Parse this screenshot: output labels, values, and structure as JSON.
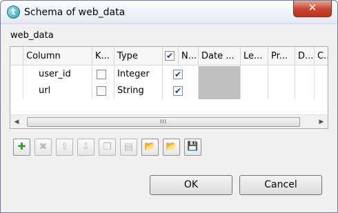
{
  "window": {
    "title": "Schema of web_data",
    "close_glyph": "✕",
    "app_icon_letter": "t"
  },
  "group_label": "web_data",
  "table": {
    "columns": [
      "Column",
      "K...",
      "Type",
      "N...",
      "Date ...",
      "Le...",
      "Pr...",
      "D...",
      "C..."
    ],
    "header_checkbox_checked": true,
    "rows": [
      {
        "column": "user_id",
        "key": false,
        "type": "Integer",
        "nullable": true,
        "date_pattern": "",
        "length": "",
        "precision": "",
        "default": "",
        "comment": ""
      },
      {
        "column": "url",
        "key": false,
        "type": "String",
        "nullable": true,
        "date_pattern": "",
        "length": "",
        "precision": "",
        "default": "",
        "comment": ""
      }
    ],
    "scroll_left_glyph": "◀",
    "scroll_right_glyph": "▶",
    "scroll_thumb_grip": "III"
  },
  "toolbar": {
    "add_icon": "plus-icon",
    "remove_icon": "cross-icon",
    "move_up_icon": "arrow-up-icon",
    "move_down_icon": "arrow-down-icon",
    "copy_icon": "copy-icon",
    "paste_icon": "paste-icon",
    "import_icon": "folder-import-icon",
    "export_icon": "folder-export-icon",
    "save_icon": "save-icon",
    "add_glyph": "✚",
    "remove_glyph": "✖",
    "up_glyph": "⇧",
    "down_glyph": "⇩",
    "copy_glyph": "❐",
    "paste_glyph": "▤",
    "import_glyph": "📂",
    "export_glyph": "📂",
    "save_glyph": "💾"
  },
  "buttons": {
    "ok": "OK",
    "cancel": "Cancel"
  },
  "colors": {
    "add_green": "#2e9a2e",
    "save_blue": "#2c4fa8",
    "folder_yellow": "#d9b13b",
    "close_red": "#c8442e"
  }
}
